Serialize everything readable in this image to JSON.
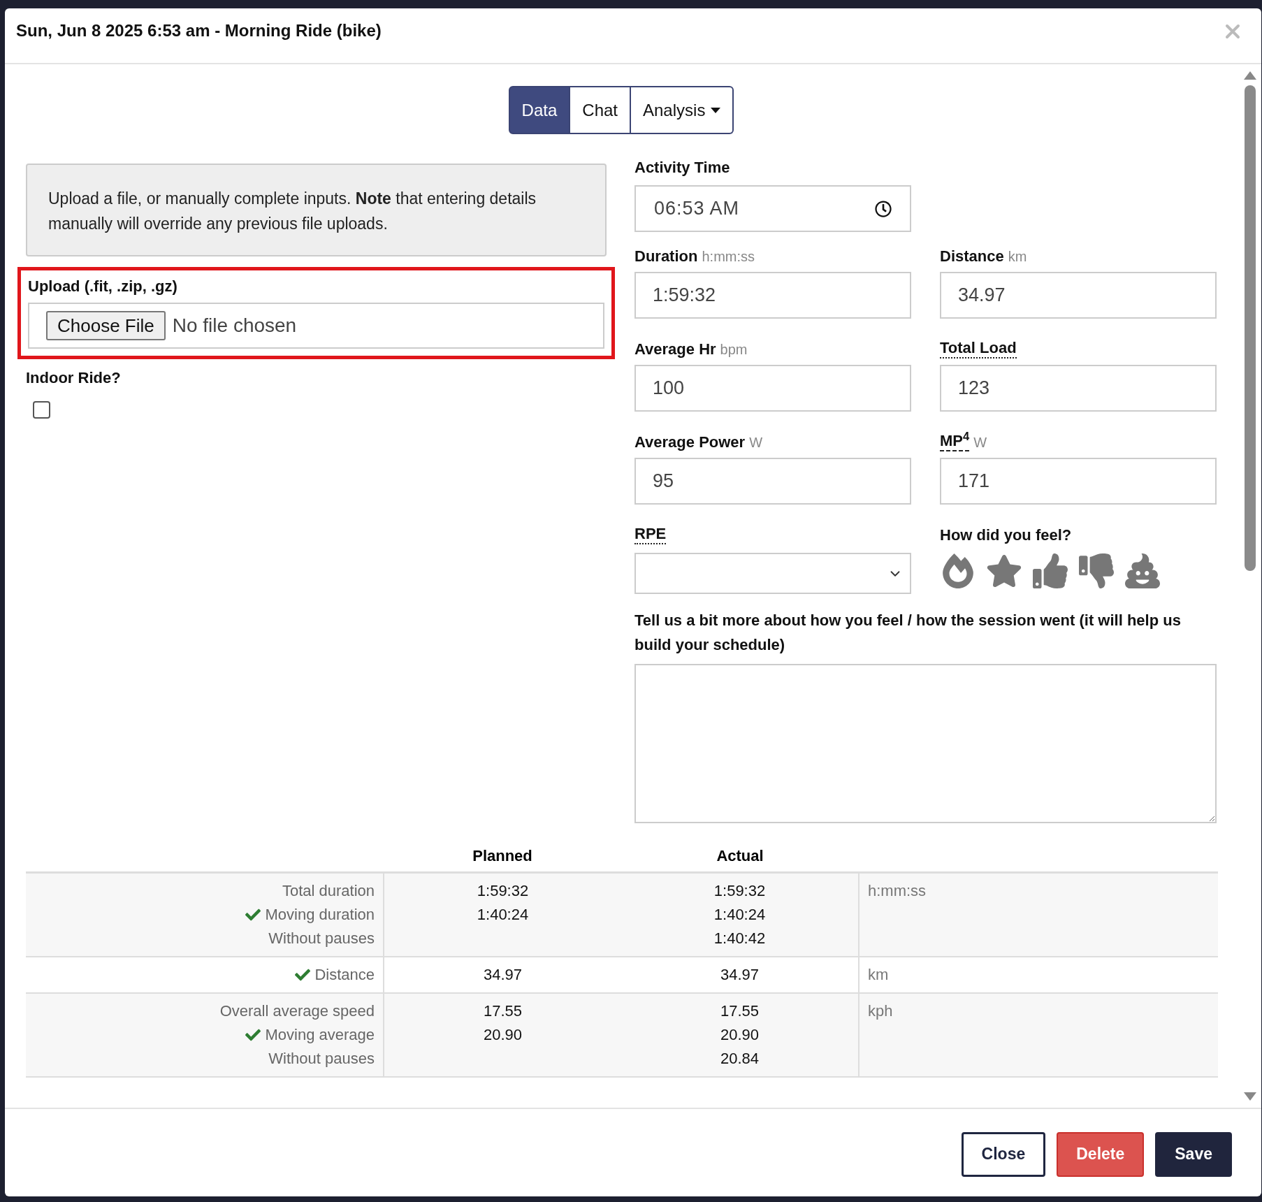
{
  "modal": {
    "title": "Sun, Jun 8 2025 6:53 am - Morning Ride (bike)"
  },
  "tabs": [
    {
      "label": "Data",
      "selected": true,
      "kind": "tab"
    },
    {
      "label": "Chat",
      "selected": false,
      "kind": "tab"
    },
    {
      "label": "Analysis",
      "selected": false,
      "kind": "dropdown"
    }
  ],
  "notice": "Upload a file, or manually complete inputs. **Note** that entering details manually will override any previous file uploads.",
  "upload": {
    "label": "Upload (.fit, .zip, .gz)",
    "button": "Choose File",
    "status": "No file chosen",
    "highlighted": true
  },
  "indoor": {
    "label": "Indoor Ride?",
    "checked": false
  },
  "activity_time": {
    "label": "Activity Time",
    "value": "06:53 AM"
  },
  "fields": [
    {
      "label": "Duration",
      "unit": "h:mm:ss",
      "value": "1:59:32",
      "kind": "text",
      "underlined": false
    },
    {
      "label": "Distance",
      "unit": "km",
      "value": "34.97",
      "kind": "text",
      "underlined": false
    },
    {
      "label": "Average Hr",
      "unit": "bpm",
      "value": "100",
      "kind": "text",
      "underlined": false
    },
    {
      "label": "Total Load",
      "value": "123",
      "kind": "text",
      "underlined": true,
      "dashed": false
    },
    {
      "label": "Average Power",
      "unit": "W",
      "value": "95",
      "kind": "text",
      "underlined": false
    },
    {
      "label": "MP$^{4}$",
      "unit": "W",
      "value": "171",
      "kind": "text",
      "underlined": true,
      "dashed": true
    },
    {
      "label": "RPE",
      "kind": "select",
      "underlined": true,
      "dashed": false
    },
    {
      "label": "How did you feel?",
      "kind": "feel",
      "underlined": false
    }
  ],
  "notes": {
    "label": "Tell us a bit more about how you feel / how the session went (it will help us build your schedule)"
  },
  "table": {
    "columns": [
      "Planned",
      "Actual"
    ],
    "rows": [
      {
        "labels": [
          {
            "text": "Total duration",
            "checked": false
          },
          {
            "text": "Moving duration",
            "checked": true
          },
          {
            "text": "Without pauses",
            "checked": false
          }
        ],
        "planned": [
          "1:59:32",
          "1:40:24"
        ],
        "actual": [
          "1:59:32",
          "1:40:24",
          "1:40:42"
        ],
        "unit": "h:mm:ss"
      },
      {
        "labels": [
          {
            "text": "Distance",
            "checked": true
          }
        ],
        "planned": [
          "34.97"
        ],
        "actual": [
          "34.97"
        ],
        "unit": "km"
      },
      {
        "labels": [
          {
            "text": "Overall average speed",
            "checked": false
          },
          {
            "text": "Moving average",
            "checked": true
          },
          {
            "text": "Without pauses",
            "checked": false
          }
        ],
        "planned": [
          "17.55",
          "20.90"
        ],
        "actual": [
          "17.55",
          "20.90",
          "20.84"
        ],
        "unit": "kph"
      }
    ]
  },
  "buttons": [
    {
      "label": "Close",
      "kind": "outline"
    },
    {
      "label": "Delete",
      "kind": "danger"
    },
    {
      "label": "Save",
      "kind": "primary"
    }
  ]
}
